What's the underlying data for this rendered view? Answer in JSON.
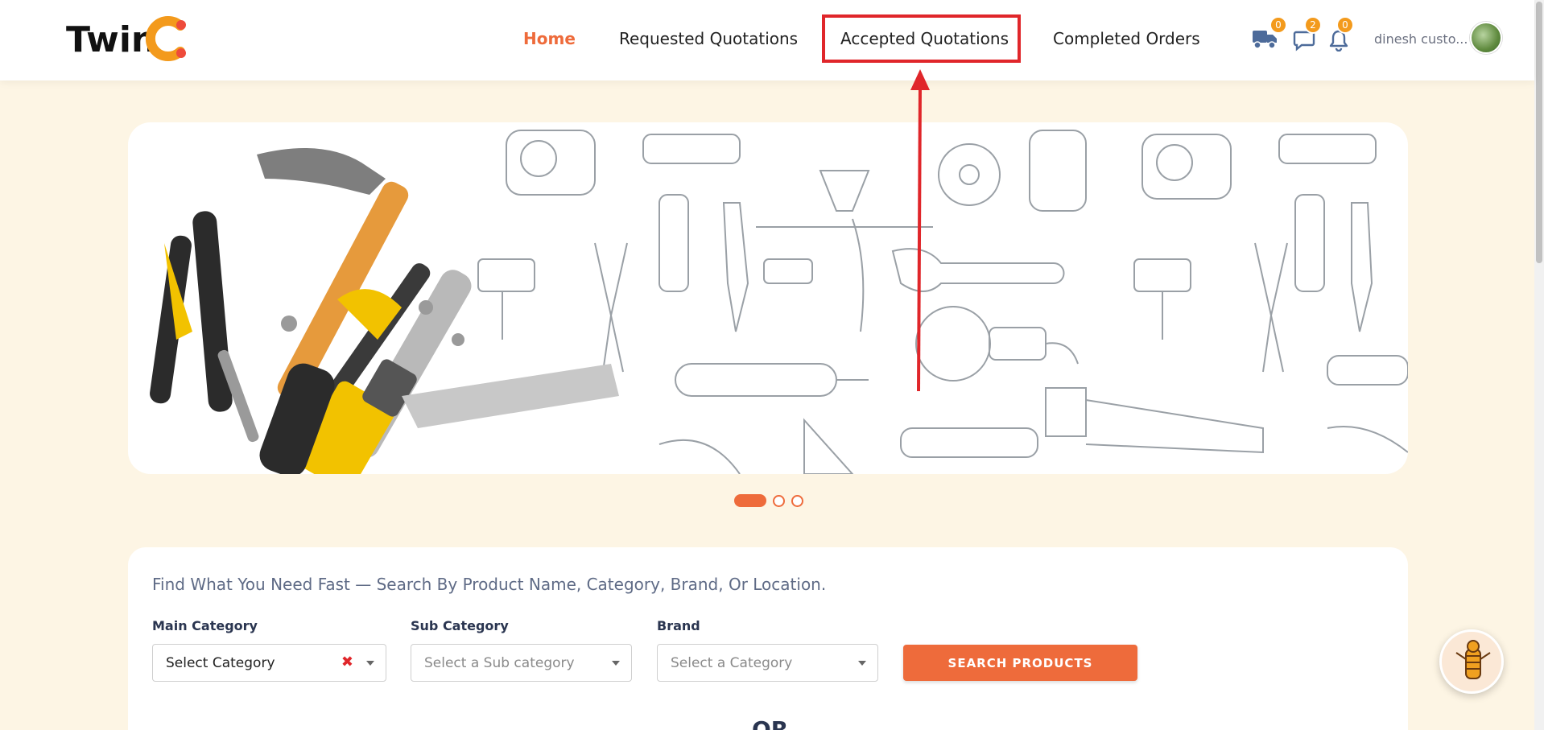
{
  "brand": {
    "logo_text": "TwinC"
  },
  "nav": {
    "home": "Home",
    "requested": "Requested Quotations",
    "accepted": "Accepted Quotations",
    "completed": "Completed Orders"
  },
  "icons": {
    "truck": {
      "name": "truck-icon",
      "badge": "0"
    },
    "chat": {
      "name": "chat-icon",
      "badge": "2"
    },
    "bell": {
      "name": "bell-icon",
      "badge": "0"
    }
  },
  "user": {
    "name": "dinesh custo..."
  },
  "carousel": {
    "slides": 3,
    "active": 1
  },
  "search": {
    "heading": "Find What You Need Fast — Search By Product Name, Category, Brand, Or Location.",
    "main_category_label": "Main Category",
    "main_category_value": "Select Category",
    "sub_category_label": "Sub Category",
    "sub_category_placeholder": "Select a Sub category",
    "brand_label": "Brand",
    "brand_placeholder": "Select a Category",
    "button": "SEARCH PRODUCTS",
    "or": "OR"
  },
  "colors": {
    "accent": "#ee6b3b",
    "highlight": "#e0262a",
    "badge": "#f39a1c",
    "page_bg": "#fdf5e4"
  }
}
